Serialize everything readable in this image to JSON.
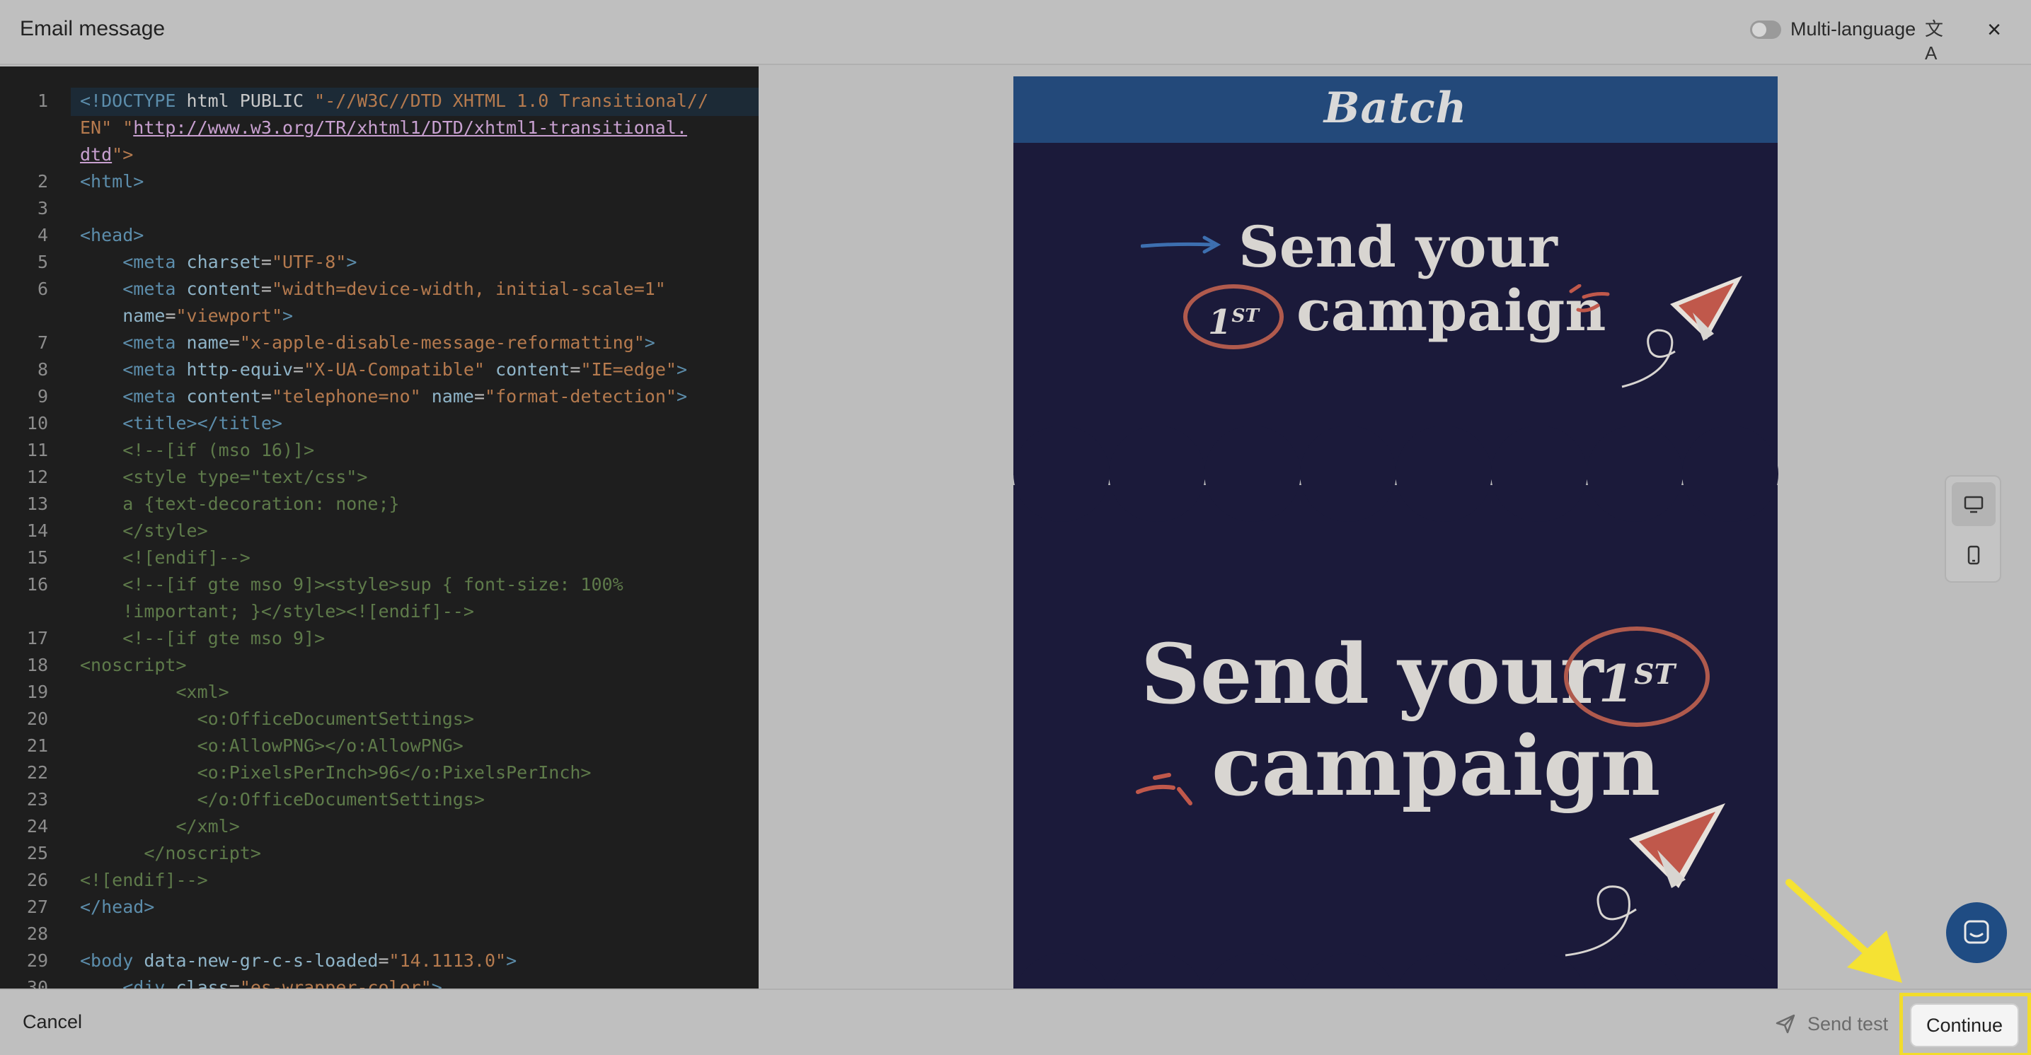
{
  "header": {
    "title": "Email message",
    "multi_language_label": "Multi-language",
    "close_glyph": "×",
    "translate_glyph": "文A"
  },
  "editor": {
    "lines": [
      {
        "n": "1",
        "parts": [
          [
            "c-tag",
            "<!DOCTYPE"
          ],
          [
            "c-txt",
            " html PUBLIC "
          ],
          [
            "c-val",
            "\"-//W3C//DTD XHTML 1.0 Transitional//"
          ]
        ]
      },
      {
        "n": "",
        "parts": [
          [
            "c-val",
            "EN\" \""
          ],
          [
            "c-link",
            "http://www.w3.org/TR/xhtml1/DTD/xhtml1-transitional."
          ]
        ]
      },
      {
        "n": "",
        "parts": [
          [
            "c-link",
            "dtd"
          ],
          [
            "c-val",
            "\">"
          ]
        ]
      },
      {
        "n": "2",
        "parts": [
          [
            "c-tag",
            "<html>"
          ]
        ]
      },
      {
        "n": "3",
        "parts": []
      },
      {
        "n": "4",
        "parts": [
          [
            "c-tag",
            "<head>"
          ]
        ]
      },
      {
        "n": "5",
        "parts": [
          [
            "c-plain",
            "    "
          ],
          [
            "c-tag",
            "<meta "
          ],
          [
            "c-attr",
            "charset"
          ],
          [
            "c-plain",
            "="
          ],
          [
            "c-val",
            "\"UTF-8\""
          ],
          [
            "c-tag",
            ">"
          ]
        ]
      },
      {
        "n": "6",
        "parts": [
          [
            "c-plain",
            "    "
          ],
          [
            "c-tag",
            "<meta "
          ],
          [
            "c-attr",
            "content"
          ],
          [
            "c-plain",
            "="
          ],
          [
            "c-val",
            "\"width=device-width, initial-scale=1\""
          ]
        ]
      },
      {
        "n": "",
        "parts": [
          [
            "c-plain",
            "    "
          ],
          [
            "c-attr",
            "name"
          ],
          [
            "c-plain",
            "="
          ],
          [
            "c-val",
            "\"viewport\""
          ],
          [
            "c-tag",
            ">"
          ]
        ]
      },
      {
        "n": "7",
        "parts": [
          [
            "c-plain",
            "    "
          ],
          [
            "c-tag",
            "<meta "
          ],
          [
            "c-attr",
            "name"
          ],
          [
            "c-plain",
            "="
          ],
          [
            "c-val",
            "\"x-apple-disable-message-reformatting\""
          ],
          [
            "c-tag",
            ">"
          ]
        ]
      },
      {
        "n": "8",
        "parts": [
          [
            "c-plain",
            "    "
          ],
          [
            "c-tag",
            "<meta "
          ],
          [
            "c-attr",
            "http-equiv"
          ],
          [
            "c-plain",
            "="
          ],
          [
            "c-val",
            "\"X-UA-Compatible\""
          ],
          [
            "c-plain",
            " "
          ],
          [
            "c-attr",
            "content"
          ],
          [
            "c-plain",
            "="
          ],
          [
            "c-val",
            "\"IE=edge\""
          ],
          [
            "c-tag",
            ">"
          ]
        ]
      },
      {
        "n": "9",
        "parts": [
          [
            "c-plain",
            "    "
          ],
          [
            "c-tag",
            "<meta "
          ],
          [
            "c-attr",
            "content"
          ],
          [
            "c-plain",
            "="
          ],
          [
            "c-val",
            "\"telephone=no\""
          ],
          [
            "c-plain",
            " "
          ],
          [
            "c-attr",
            "name"
          ],
          [
            "c-plain",
            "="
          ],
          [
            "c-val",
            "\"format-detection\""
          ],
          [
            "c-tag",
            ">"
          ]
        ]
      },
      {
        "n": "10",
        "parts": [
          [
            "c-plain",
            "    "
          ],
          [
            "c-tag",
            "<title></title>"
          ]
        ]
      },
      {
        "n": "11",
        "parts": [
          [
            "c-plain",
            "    "
          ],
          [
            "c-cmt",
            "<!--[if (mso 16)]>"
          ]
        ]
      },
      {
        "n": "12",
        "parts": [
          [
            "c-plain",
            "    "
          ],
          [
            "c-cmt",
            "<style type=\"text/css\">"
          ]
        ]
      },
      {
        "n": "13",
        "parts": [
          [
            "c-plain",
            "    "
          ],
          [
            "c-cmt",
            "a {text-decoration: none;}"
          ]
        ]
      },
      {
        "n": "14",
        "parts": [
          [
            "c-plain",
            "    "
          ],
          [
            "c-cmt",
            "</style>"
          ]
        ]
      },
      {
        "n": "15",
        "parts": [
          [
            "c-plain",
            "    "
          ],
          [
            "c-cmt",
            "<![endif]-->"
          ]
        ]
      },
      {
        "n": "16",
        "parts": [
          [
            "c-plain",
            "    "
          ],
          [
            "c-cmt",
            "<!--[if gte mso 9]><style>sup { font-size: 100%"
          ]
        ]
      },
      {
        "n": "",
        "parts": [
          [
            "c-plain",
            "    "
          ],
          [
            "c-cmt",
            "!important; }</style><![endif]-->"
          ]
        ]
      },
      {
        "n": "17",
        "parts": [
          [
            "c-plain",
            "    "
          ],
          [
            "c-cmt",
            "<!--[if gte mso 9]>"
          ]
        ]
      },
      {
        "n": "18",
        "parts": [
          [
            "c-cmt",
            "<noscript>"
          ]
        ]
      },
      {
        "n": "19",
        "parts": [
          [
            "c-plain",
            "         "
          ],
          [
            "c-cmt",
            "<xml>"
          ]
        ]
      },
      {
        "n": "20",
        "parts": [
          [
            "c-plain",
            "           "
          ],
          [
            "c-cmt",
            "<o:OfficeDocumentSettings>"
          ]
        ]
      },
      {
        "n": "21",
        "parts": [
          [
            "c-plain",
            "           "
          ],
          [
            "c-cmt",
            "<o:AllowPNG></o:AllowPNG>"
          ]
        ]
      },
      {
        "n": "22",
        "parts": [
          [
            "c-plain",
            "           "
          ],
          [
            "c-cmt",
            "<o:PixelsPerInch>96</o:PixelsPerInch>"
          ]
        ]
      },
      {
        "n": "23",
        "parts": [
          [
            "c-plain",
            "           "
          ],
          [
            "c-cmt",
            "</o:OfficeDocumentSettings>"
          ]
        ]
      },
      {
        "n": "24",
        "parts": [
          [
            "c-plain",
            "         "
          ],
          [
            "c-cmt",
            "</xml>"
          ]
        ]
      },
      {
        "n": "25",
        "parts": [
          [
            "c-plain",
            "      "
          ],
          [
            "c-cmt",
            "</noscript>"
          ]
        ]
      },
      {
        "n": "26",
        "parts": [
          [
            "c-cmt",
            "<![endif]-->"
          ]
        ]
      },
      {
        "n": "27",
        "parts": [
          [
            "c-tag",
            "</head>"
          ]
        ]
      },
      {
        "n": "28",
        "parts": []
      },
      {
        "n": "29",
        "parts": [
          [
            "c-tag",
            "<body "
          ],
          [
            "c-attr",
            "data-new-gr-c-s-loaded"
          ],
          [
            "c-plain",
            "="
          ],
          [
            "c-val",
            "\"14.1113.0\""
          ],
          [
            "c-tag",
            ">"
          ]
        ]
      },
      {
        "n": "30",
        "parts": [
          [
            "c-plain",
            "    "
          ],
          [
            "c-tag",
            "<div "
          ],
          [
            "c-attr",
            "class"
          ],
          [
            "c-plain",
            "="
          ],
          [
            "c-val",
            "\"es-wrapper-color\""
          ],
          [
            "c-tag",
            ">"
          ]
        ]
      }
    ]
  },
  "preview": {
    "brand": "Batch",
    "banner1": {
      "line1": "Send your",
      "badge": "1",
      "badge_sup": "ST",
      "line2": "campaign"
    },
    "banner2": {
      "line1": "Send your",
      "badge": "1",
      "badge_sup": "ST",
      "line2": "campaign"
    }
  },
  "view_switch": {
    "desktop_icon": "desktop-icon",
    "mobile_icon": "mobile-icon"
  },
  "footer": {
    "cancel_label": "Cancel",
    "send_test_label": "Send test",
    "continue_label": "Continue"
  },
  "colors": {
    "brand_bar": "#23497a",
    "banner": "#1b1a3a",
    "accent": "#b05a4d",
    "highlight": "#f2dc2b",
    "chat": "#1f4c83"
  }
}
